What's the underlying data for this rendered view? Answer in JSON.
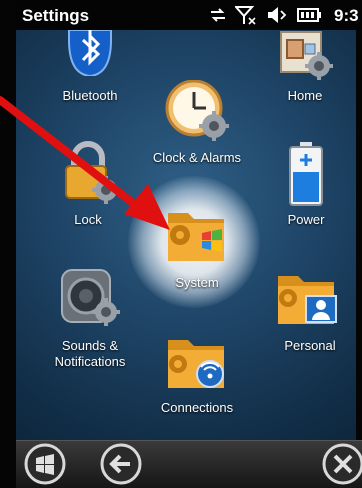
{
  "status_bar": {
    "title": "Settings",
    "time": "9:3",
    "icons": [
      "data-sync-icon",
      "no-signal-icon",
      "speaker-icon",
      "battery-icon"
    ]
  },
  "tiles": [
    {
      "label": "Bluetooth",
      "icon": "bluetooth-icon"
    },
    {
      "label": "Home",
      "icon": "home-icon"
    },
    {
      "label": "Clock & Alarms",
      "icon": "clock-icon"
    },
    {
      "label": "Lock",
      "icon": "padlock-icon"
    },
    {
      "label": "Power",
      "icon": "battery-power-icon"
    },
    {
      "label": "System",
      "icon": "system-folder-icon"
    },
    {
      "label": "Sounds &\nNotifications",
      "icon": "speaker-gear-icon"
    },
    {
      "label": "Personal",
      "icon": "personal-folder-icon"
    },
    {
      "label": "Connections",
      "icon": "connections-folder-icon"
    }
  ],
  "softkeys": {
    "start": "windows-start-icon",
    "back": "back-arrow-icon",
    "close": "close-icon"
  },
  "colors": {
    "folder": "#f0a830",
    "annotation_arrow": "#e01010",
    "status_bar": "#040404"
  }
}
